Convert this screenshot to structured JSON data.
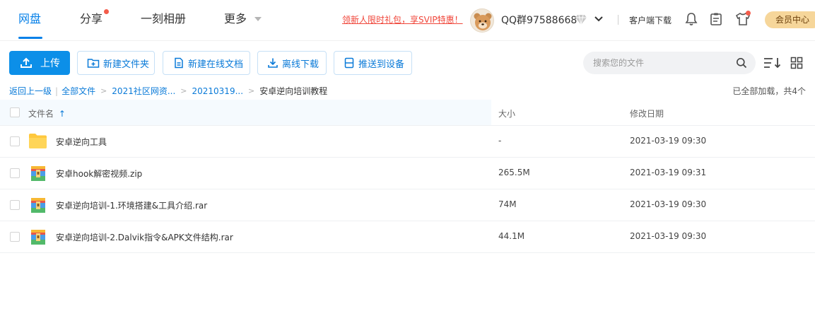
{
  "nav": {
    "tabs": [
      {
        "label": "网盘",
        "active": true
      },
      {
        "label": "分享",
        "badge": true
      },
      {
        "label": "一刻相册"
      },
      {
        "label": "更多",
        "dropdown": true
      }
    ]
  },
  "header": {
    "promo_link": "领新人限时礼包，享SVIP特惠！",
    "username": "QQ群97588668",
    "client_download": "客户端下载",
    "vip_center": "会员中心",
    "icons": [
      "bell-icon",
      "clipboard-icon",
      "shirt-icon"
    ]
  },
  "toolbar": {
    "upload": "上传",
    "new_folder": "新建文件夹",
    "new_doc": "新建在线文档",
    "offline_download": "离线下载",
    "push_device": "推送到设备",
    "search_placeholder": "搜索您的文件"
  },
  "breadcrumb": {
    "back": "返回上一级",
    "all_files": "全部文件",
    "level1": "2021社区网资...",
    "level2": "20210319...",
    "current": "安卓逆向培训教程",
    "loaded_text": "已全部加载，共4个"
  },
  "table": {
    "headers": {
      "name": "文件名",
      "size": "大小",
      "date": "修改日期"
    },
    "sort_indicator": "↑",
    "rows": [
      {
        "name": "安卓逆向工具",
        "size": "-",
        "date": "2021-03-19 09:30",
        "type": "folder"
      },
      {
        "name": "安卓hook解密视频.zip",
        "size": "265.5M",
        "date": "2021-03-19 09:31",
        "type": "archive"
      },
      {
        "name": "安卓逆向培训-1.环境搭建&工具介绍.rar",
        "size": "74M",
        "date": "2021-03-19 09:30",
        "type": "archive"
      },
      {
        "name": "安卓逆向培训-2.Dalvik指令&APK文件结构.rar",
        "size": "44.1M",
        "date": "2021-03-19 09:30",
        "type": "archive"
      }
    ]
  },
  "colors": {
    "accent": "#0680e8",
    "promo": "#f0463a",
    "vip": "#f6d69a"
  }
}
